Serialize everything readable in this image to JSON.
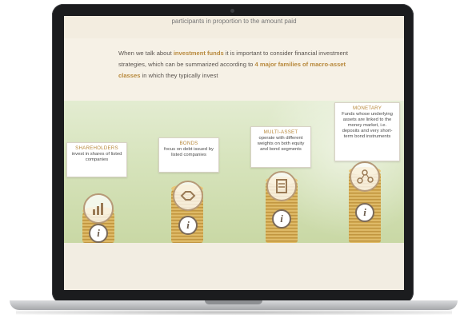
{
  "page": {
    "top_line": "participants in proportion to the amount paid",
    "intro": {
      "p1": "When we talk about ",
      "p1_bold": "investment funds",
      "p2": " it is important to consider financial investment strategies, which can be summarized according to ",
      "p2_bold": "4 major families of macro-asset classes",
      "p3": " in which they typically invest"
    }
  },
  "cards": [
    {
      "title": "SHAREHOLDERS",
      "desc": "invest in shares of listed companies",
      "icon": "chart-icon"
    },
    {
      "title": "BONDS",
      "desc": "focus on debt issued by listed companies",
      "icon": "handshake-icon"
    },
    {
      "title": "MULTI-ASSET",
      "desc": "operate with different weights on both equity and bond segments",
      "icon": "document-icon"
    },
    {
      "title": "MONETARY",
      "desc": "Funds whose underlying assets are linked to the money market, i.e. deposits and very short-term bond instruments",
      "icon": "network-icon"
    }
  ],
  "info_glyph": "i",
  "colors": {
    "accent": "#b8893c",
    "band": "#d6e3bb",
    "laptop": "#1b1c1e"
  }
}
